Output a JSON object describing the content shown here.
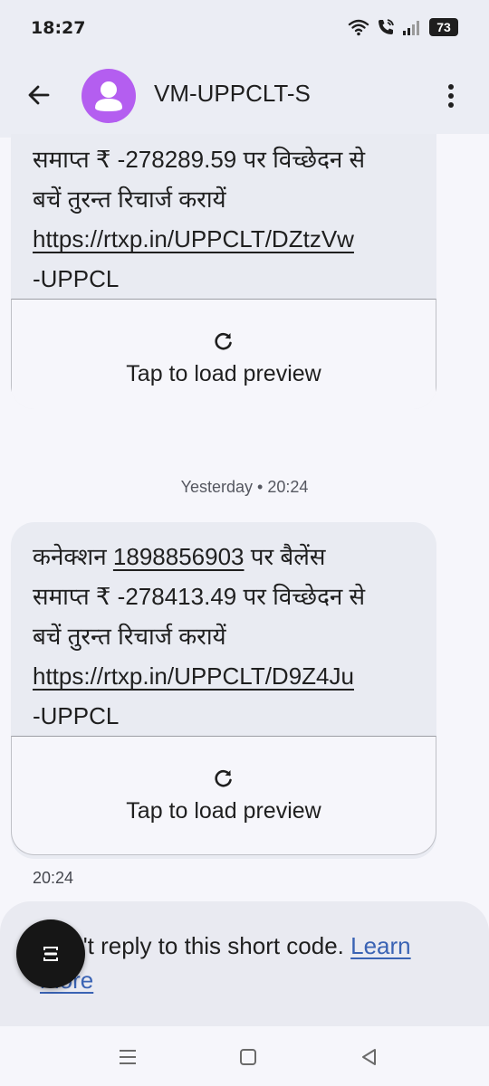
{
  "status_bar": {
    "time": "18:27",
    "battery": "73"
  },
  "header": {
    "title": "VM-UPPCLT-S"
  },
  "messages": [
    {
      "line2": "समाप्त ₹ -278289.59 पर विच्छेदन से",
      "line3": "बचें तुरन्त रिचार्ज करायें",
      "link": "https://rtxp.in/UPPCLT/DZtzVw",
      "signature": "-UPPCL",
      "preview_label": "Tap to load preview"
    },
    {
      "line1_prefix": "कनेक्शन",
      "connection_number": "1898856903",
      "line1_suffix": "पर बैलेंस",
      "line2": "समाप्त ₹ -278413.49 पर विच्छेदन से",
      "line3": "बचें तुरन्त रिचार्ज करायें",
      "link": "https://rtxp.in/UPPCLT/D9Z4Ju",
      "signature": "-UPPCL",
      "preview_label": "Tap to load preview",
      "time": "20:24"
    }
  ],
  "date_divider": "Yesterday • 20:24",
  "reply_bar": {
    "text": "Can't reply to this short code.",
    "link": "Learn more"
  },
  "icons": [
    "wifi-icon",
    "call-icon",
    "signal-icon",
    "back-arrow-icon",
    "person-icon",
    "more-vert-icon",
    "reload-icon",
    "lens-icon",
    "recents-icon",
    "home-icon",
    "back-nav-icon"
  ]
}
